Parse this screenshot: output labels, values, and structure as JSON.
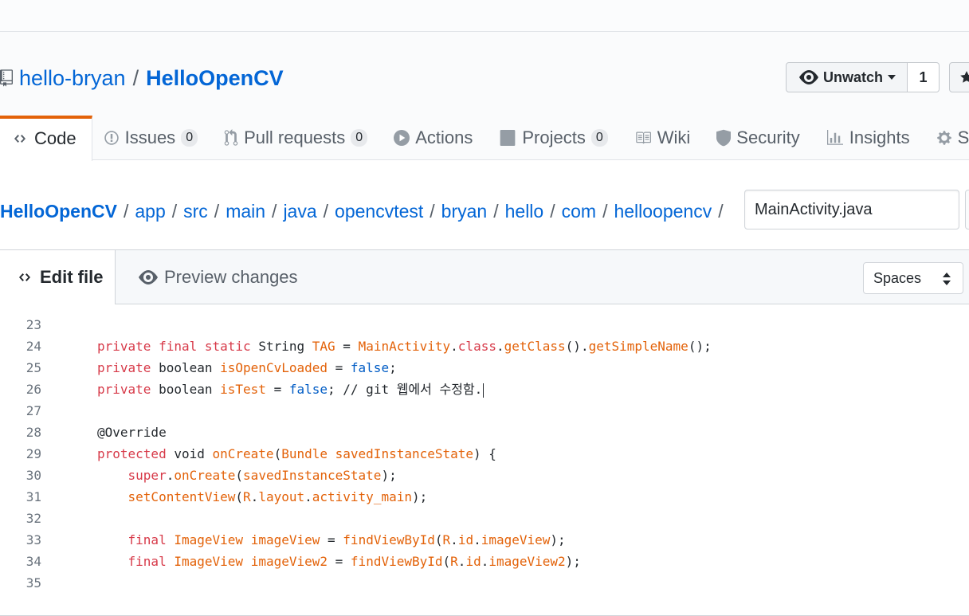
{
  "repo": {
    "owner": "hello-bryan",
    "separator": "/",
    "name": "HelloOpenCV"
  },
  "watch": {
    "label": "Unwatch",
    "count": "1"
  },
  "nav_tabs": [
    {
      "label": "Code"
    },
    {
      "label": "Issues",
      "count": "0"
    },
    {
      "label": "Pull requests",
      "count": "0"
    },
    {
      "label": "Actions"
    },
    {
      "label": "Projects",
      "count": "0"
    },
    {
      "label": "Wiki"
    },
    {
      "label": "Security"
    },
    {
      "label": "Insights"
    },
    {
      "label": "S"
    }
  ],
  "breadcrumb": {
    "segments": [
      "HelloOpenCV",
      "app",
      "src",
      "main",
      "java",
      "opencvtest",
      "bryan",
      "hello",
      "com",
      "helloopencv"
    ],
    "separator": "/",
    "filename": "MainActivity.java"
  },
  "editor": {
    "edit_tab": "Edit file",
    "preview_tab": "Preview changes",
    "indent_mode": "Spaces",
    "line_numbers": [
      "23",
      "24",
      "25",
      "26",
      "27",
      "28",
      "29",
      "30",
      "31",
      "32",
      "33",
      "34",
      "35"
    ]
  },
  "colors": {
    "link": "#0366d6",
    "keyword": "#d73a49",
    "identifier": "#e36209",
    "constant": "#005cc5",
    "selected_tab_accent": "#e36209"
  },
  "icons": {
    "repo": "repo-icon",
    "eye": "eye-icon",
    "star": "star-icon",
    "code": "code-icon",
    "issue": "issue-opened-icon",
    "pr": "git-pull-request-icon",
    "actions": "play-icon",
    "projects": "project-icon",
    "wiki": "book-icon",
    "security": "shield-icon",
    "insights": "graph-icon",
    "settings": "gear-icon"
  }
}
